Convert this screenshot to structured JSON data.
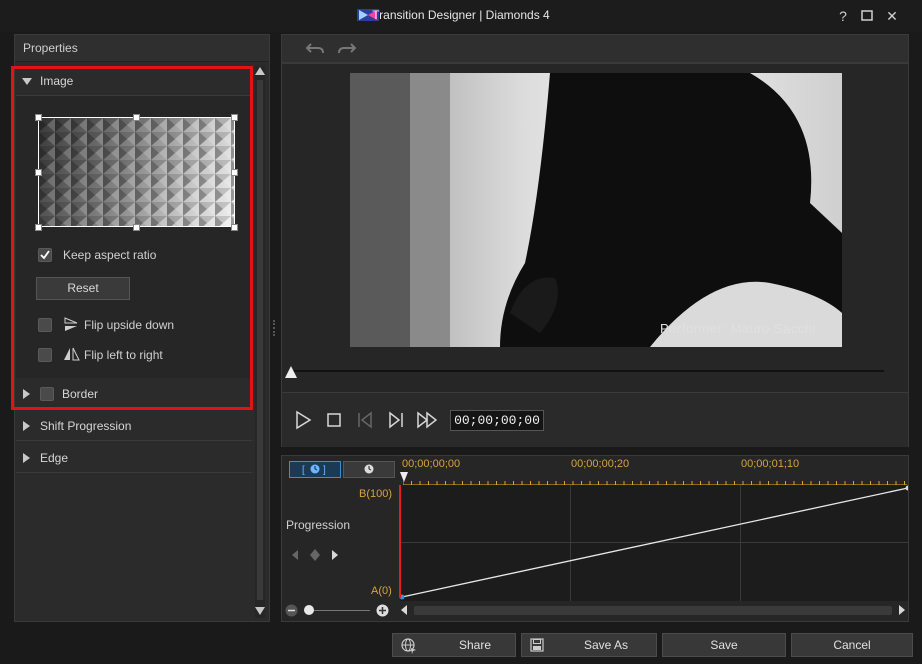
{
  "window": {
    "title": "Transition Designer  |  Diamonds 4",
    "help_label": "?",
    "maximize_label": "☐",
    "close_label": "✕"
  },
  "properties": {
    "title": "Properties",
    "sections": {
      "image": {
        "label": "Image",
        "expanded": true
      },
      "border": {
        "label": "Border",
        "expanded": false,
        "checked": false
      },
      "shift_progression": {
        "label": "Shift Progression",
        "expanded": false
      },
      "edge": {
        "label": "Edge",
        "expanded": false
      }
    },
    "keep_aspect_ratio": {
      "label": "Keep aspect ratio",
      "checked": true
    },
    "reset_label": "Reset",
    "flip_upside_down": {
      "label": "Flip upside down",
      "checked": false
    },
    "flip_left_to_right": {
      "label": "Flip left to right",
      "checked": false
    }
  },
  "toolbar": {
    "undo_icon": "undo-icon",
    "redo_icon": "redo-icon"
  },
  "preview": {
    "caption": "Performer: Mauro Sacchi",
    "timecode": "00;00;00;00"
  },
  "timeline": {
    "ruler_labels": [
      "00;00;00;00",
      "00;00;00;20",
      "00;00;01;10"
    ],
    "track_label": "Progression",
    "y_max_label": "B(100)",
    "y_min_label": "A(0)",
    "keyframes": [
      {
        "time": "00;00;00;00",
        "value": 0
      },
      {
        "time": "end",
        "value": 100
      }
    ]
  },
  "footer": {
    "share_label": "Share",
    "save_as_label": "Save As",
    "save_label": "Save",
    "cancel_label": "Cancel"
  },
  "colors": {
    "accent_blue": "#3b8fd6",
    "highlight_red": "#e41212",
    "timecode_orange": "#d8a33a"
  }
}
